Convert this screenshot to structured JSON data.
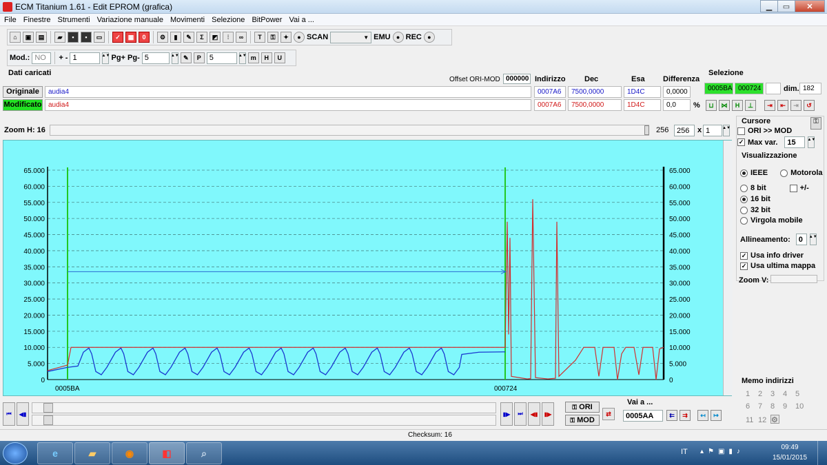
{
  "window": {
    "title": "ECM Titanium 1.61 - Edit EPROM (grafica)"
  },
  "menu": [
    "File",
    "Finestre",
    "Strumenti",
    "Variazione manuale",
    "Movimenti",
    "Selezione",
    "BitPower",
    "Vai a ..."
  ],
  "toolbar": {
    "scan_label": "SCAN",
    "emu_label": "EMU",
    "rec_label": "REC"
  },
  "toolbar2": {
    "mod_label": "Mod.:",
    "mod_value": "NO",
    "plusminus_label": "+ -",
    "plusminus_value": "1",
    "pg_label": "Pg+ Pg-",
    "pg_value": "5",
    "p_value": "5"
  },
  "dati": {
    "title": "Dati caricati",
    "offset_label": "Offset ORI-MOD",
    "offset_value": "000000",
    "col_indirizzo": "Indirizzo",
    "col_dec": "Dec",
    "col_esa": "Esa",
    "col_diff": "Differenza",
    "originale": {
      "label": "Originale",
      "name": "audia4",
      "indirizzo": "0007A6",
      "dec": "7500,0000",
      "esa": "1D4C",
      "diff": "0,0000"
    },
    "modificato": {
      "label": "Modificato",
      "name": "audia4",
      "indirizzo": "0007A6",
      "dec": "7500,0000",
      "esa": "1D4C",
      "diff": "0,0",
      "unit": "%"
    }
  },
  "selezione": {
    "title": "Selezione",
    "start": "0005BA",
    "end": "000724",
    "dim_label": "dim.",
    "dim_value": "182"
  },
  "zoom": {
    "label": "Zoom H: 16",
    "value1": "256",
    "value2": "256",
    "mult_label": "x",
    "mult_value": "1"
  },
  "cursore": {
    "title": "Cursore",
    "ori_mod": "ORI >> MOD",
    "maxvar_label": "Max var.",
    "maxvar_value": "15"
  },
  "visual": {
    "title": "Visualizzazione",
    "ieee": "IEEE",
    "motorola": "Motorola",
    "bit8": "8 bit",
    "plusminus": "+/-",
    "bit16": "16 bit",
    "bit32": "32 bit",
    "virgola": "Virgola mobile",
    "allineamento_label": "Allineamento:",
    "allineamento_value": "0",
    "usa_info": "Usa info driver",
    "usa_ultima": "Usa ultima mappa",
    "zoomv": "Zoom V:"
  },
  "memo": {
    "title": "Memo indirizzi",
    "nums": [
      "1",
      "2",
      "3",
      "4",
      "5",
      "6",
      "7",
      "8",
      "9",
      "10",
      "11",
      "12"
    ]
  },
  "nav": {
    "ori_label": "ORI",
    "mod_label": "MOD",
    "vai_label": "Vai a ...",
    "vai_value": "0005AA"
  },
  "status": {
    "checksum": "Checksum: 16"
  },
  "tray": {
    "lang": "IT",
    "time": "09:49",
    "date": "15/01/2015"
  },
  "colors": {
    "plot_bg": "#80f8fc",
    "ori_line": "#1a3ad0",
    "mod_line": "#d03030",
    "marker": "#22c822"
  },
  "chart_data": {
    "type": "line",
    "y_ticks": [
      "65.000",
      "60.000",
      "55.000",
      "50.000",
      "45.000",
      "40.000",
      "35.000",
      "30.000",
      "25.000",
      "20.000",
      "15.000",
      "10.000",
      "5.000",
      "0"
    ],
    "ylim": [
      0,
      65000
    ],
    "x_labels": [
      "0005BA",
      "000724"
    ],
    "grid": true,
    "series": []
  }
}
